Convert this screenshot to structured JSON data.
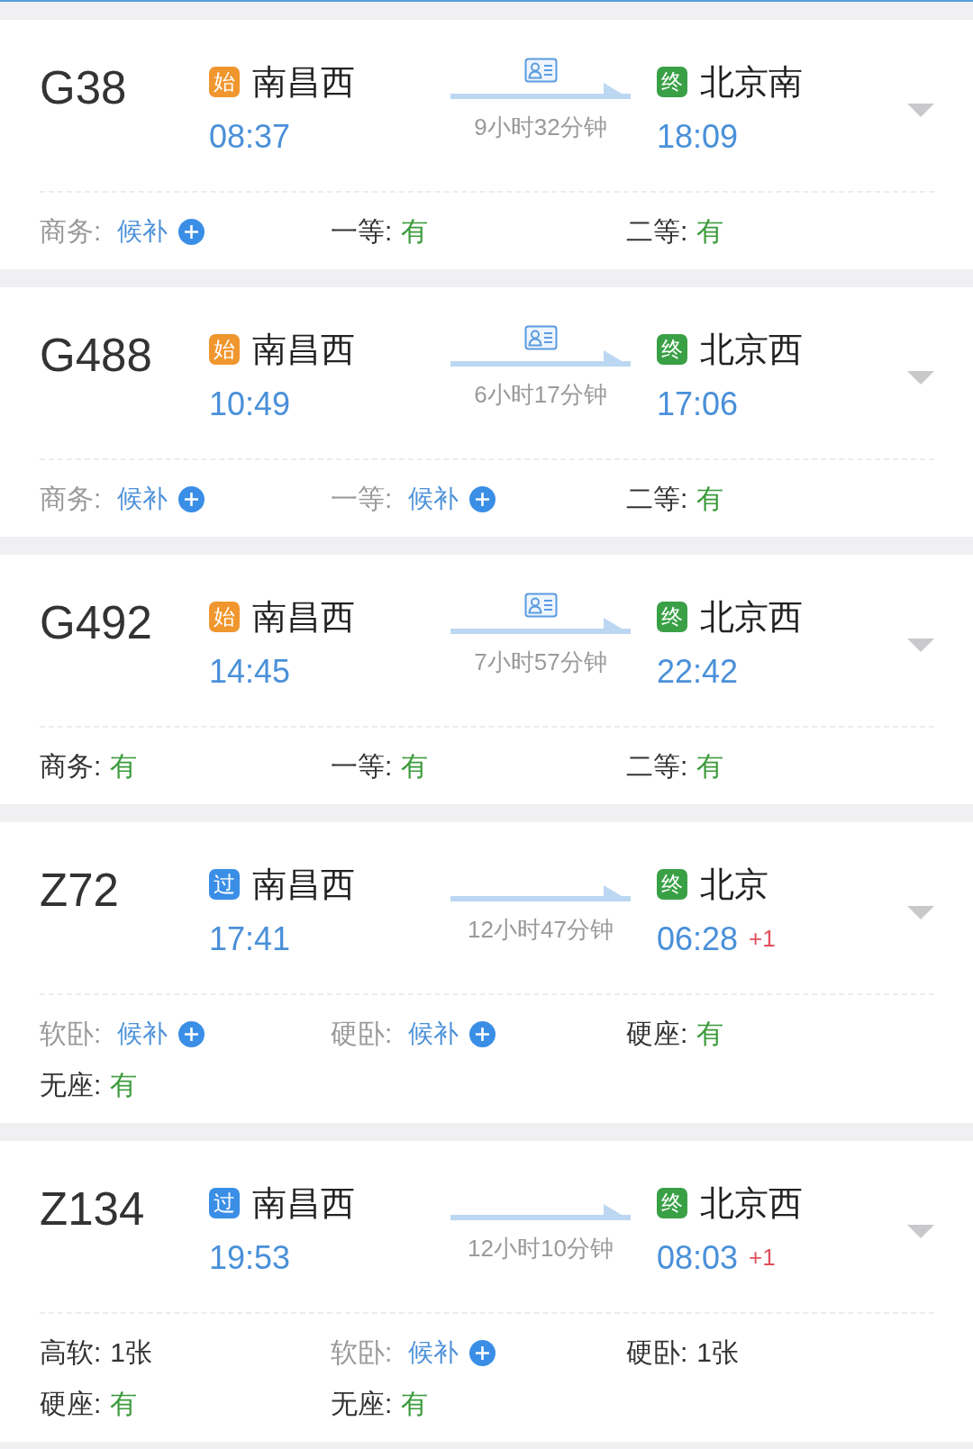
{
  "trains": [
    {
      "number": "G38",
      "departure": {
        "tag": "始",
        "color": "#f0962e",
        "station": "南昌西",
        "time": "08:37"
      },
      "id_card": true,
      "duration": "9小时32分钟",
      "arrival": {
        "tag": "终",
        "color": "#3aa046",
        "station": "北京南",
        "time": "18:09"
      },
      "seats": [
        {
          "label": "商务:",
          "kind": "waitlist",
          "value": "候补"
        },
        {
          "label": "一等:",
          "kind": "available",
          "value": "有"
        },
        {
          "label": "二等:",
          "kind": "available",
          "value": "有"
        }
      ]
    },
    {
      "number": "G488",
      "departure": {
        "tag": "始",
        "color": "#f0962e",
        "station": "南昌西",
        "time": "10:49"
      },
      "id_card": true,
      "duration": "6小时17分钟",
      "arrival": {
        "tag": "终",
        "color": "#3aa046",
        "station": "北京西",
        "time": "17:06"
      },
      "seats": [
        {
          "label": "商务:",
          "kind": "waitlist",
          "value": "候补"
        },
        {
          "label": "一等:",
          "kind": "waitlist",
          "value": "候补"
        },
        {
          "label": "二等:",
          "kind": "available",
          "value": "有"
        }
      ]
    },
    {
      "number": "G492",
      "departure": {
        "tag": "始",
        "color": "#f0962e",
        "station": "南昌西",
        "time": "14:45"
      },
      "id_card": true,
      "duration": "7小时57分钟",
      "arrival": {
        "tag": "终",
        "color": "#3aa046",
        "station": "北京西",
        "time": "22:42"
      },
      "seats": [
        {
          "label": "商务:",
          "kind": "available",
          "value": "有"
        },
        {
          "label": "一等:",
          "kind": "available",
          "value": "有"
        },
        {
          "label": "二等:",
          "kind": "available",
          "value": "有"
        }
      ]
    },
    {
      "number": "Z72",
      "departure": {
        "tag": "过",
        "color": "#3a8ee6",
        "station": "南昌西",
        "time": "17:41"
      },
      "id_card": false,
      "duration": "12小时47分钟",
      "arrival": {
        "tag": "终",
        "color": "#3aa046",
        "station": "北京",
        "time": "06:28",
        "day_offset": "+1"
      },
      "seats": [
        {
          "label": "软卧:",
          "kind": "waitlist",
          "value": "候补"
        },
        {
          "label": "硬卧:",
          "kind": "waitlist",
          "value": "候补"
        },
        {
          "label": "硬座:",
          "kind": "available",
          "value": "有"
        },
        {
          "label": "无座:",
          "kind": "available",
          "value": "有"
        }
      ]
    },
    {
      "number": "Z134",
      "departure": {
        "tag": "过",
        "color": "#3a8ee6",
        "station": "南昌西",
        "time": "19:53"
      },
      "id_card": false,
      "duration": "12小时10分钟",
      "arrival": {
        "tag": "终",
        "color": "#3aa046",
        "station": "北京西",
        "time": "08:03",
        "day_offset": "+1"
      },
      "seats": [
        {
          "label": "高软:",
          "kind": "count",
          "value": "1张"
        },
        {
          "label": "软卧:",
          "kind": "waitlist",
          "value": "候补"
        },
        {
          "label": "硬卧:",
          "kind": "count",
          "value": "1张"
        },
        {
          "label": "硬座:",
          "kind": "available",
          "value": "有"
        },
        {
          "label": "无座:",
          "kind": "available",
          "value": "有"
        }
      ]
    }
  ]
}
